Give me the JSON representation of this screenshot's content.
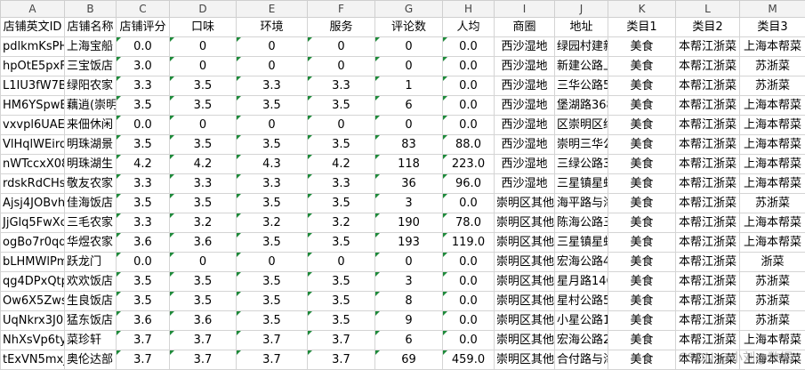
{
  "columns": [
    "A",
    "B",
    "C",
    "D",
    "E",
    "F",
    "G",
    "H",
    "I",
    "J",
    "K",
    "L",
    "M"
  ],
  "headers": [
    "店铺英文ID",
    "店铺名称",
    "店铺评分",
    "口味",
    "环境",
    "服务",
    "评论数",
    "人均",
    "商圈",
    "地址",
    "类目1",
    "类目2",
    "类目3"
  ],
  "rows": [
    [
      "pdlkmKsPH",
      "上海宝船",
      "0.0",
      "0",
      "0",
      "0",
      "0",
      "0.0",
      "西沙湿地",
      "绿园村建新",
      "美食",
      "本帮江浙菜",
      "上海本帮菜"
    ],
    [
      "hpOtE5pxFl",
      "三宝饭店",
      "3.0",
      "0",
      "0",
      "0",
      "0",
      "0.0",
      "西沙湿地",
      "新建公路上",
      "美食",
      "本帮江浙菜",
      "苏浙菜"
    ],
    [
      "L1IU3fW7B",
      "绿阳农家",
      "3.3",
      "3.5",
      "3.3",
      "3.3",
      "1",
      "0.0",
      "西沙湿地",
      "三华公路51",
      "美食",
      "本帮江浙菜",
      "苏浙菜"
    ],
    [
      "HM6YSpwB",
      "藕逍(崇明",
      "3.5",
      "3.5",
      "3.5",
      "3.5",
      "6",
      "0.0",
      "西沙湿地",
      "堡湖路368号",
      "美食",
      "本帮江浙菜",
      "上海本帮菜"
    ],
    [
      "vxvpl6UAEf",
      "来佃休闲",
      "0.0",
      "0",
      "0",
      "0",
      "0",
      "0.0",
      "西沙湿地",
      "区崇明区绿",
      "美食",
      "本帮江浙菜",
      "上海本帮菜"
    ],
    [
      "VlHqlWEird",
      "明珠湖景",
      "3.5",
      "3.5",
      "3.5",
      "3.5",
      "83",
      "88.0",
      "西沙湿地",
      "崇明三华公",
      "美食",
      "本帮江浙菜",
      "上海本帮菜"
    ],
    [
      "nWTccxX08",
      "明珠湖生",
      "4.2",
      "4.2",
      "4.3",
      "4.2",
      "118",
      "223.0",
      "西沙湿地",
      "三绿公路33",
      "美食",
      "本帮江浙菜",
      "上海本帮菜"
    ],
    [
      "rdskRdCHs",
      "敬友农家",
      "3.3",
      "3.3",
      "3.3",
      "3.3",
      "36",
      "96.0",
      "西沙湿地",
      "三星镇星虹",
      "美食",
      "本帮江浙菜",
      "上海本帮菜"
    ],
    [
      "Ajsj4JOBvh",
      "佳海饭店",
      "3.5",
      "3.5",
      "3.5",
      "3.5",
      "3",
      "0.0",
      "崇明区其他",
      "海平路与海",
      "美食",
      "本帮江浙菜",
      "苏浙菜"
    ],
    [
      "JjGlq5FwXc",
      "三毛农家",
      "3.3",
      "3.2",
      "3.2",
      "3.2",
      "190",
      "78.0",
      "崇明区其他",
      "陈海公路三",
      "美食",
      "本帮江浙菜",
      "上海本帮菜"
    ],
    [
      "ogBo7r0qqV",
      "华煜农家",
      "3.6",
      "3.6",
      "3.5",
      "3.5",
      "193",
      "119.0",
      "崇明区其他",
      "三星镇星虹",
      "美食",
      "本帮江浙菜",
      "上海本帮菜"
    ],
    [
      "bLHMWlPm",
      "跃龙门",
      "0.0",
      "0",
      "0",
      "0",
      "0",
      "0.0",
      "崇明区其他",
      "宏海公路42",
      "美食",
      "本帮江浙菜",
      "浙菜"
    ],
    [
      "qg4DPxQtp",
      "欢欢饭店",
      "3.5",
      "3.5",
      "3.5",
      "3.5",
      "3",
      "0.0",
      "崇明区其他",
      "星月路146号",
      "美食",
      "本帮江浙菜",
      "苏浙菜"
    ],
    [
      "Ow6X5Zwsu",
      "生良饭店",
      "3.5",
      "3.5",
      "3.5",
      "3.5",
      "8",
      "0.0",
      "崇明区其他",
      "星村公路59",
      "美食",
      "本帮江浙菜",
      "苏浙菜"
    ],
    [
      "UqNkrx3J0l",
      "猛东饭店",
      "3.6",
      "3.6",
      "3.5",
      "3.5",
      "9",
      "0.0",
      "崇明区其他",
      "小星公路12",
      "美食",
      "本帮江浙菜",
      "苏浙菜"
    ],
    [
      "NhXsVp6ty",
      "菜珍轩",
      "3.7",
      "3.7",
      "3.7",
      "3.7",
      "6",
      "0.0",
      "崇明区其他",
      "宏海公路20",
      "美食",
      "本帮江浙菜",
      "上海本帮菜"
    ],
    [
      "tExVN5mxj",
      "奥伦达部",
      "3.7",
      "3.7",
      "3.7",
      "3.7",
      "69",
      "459.0",
      "崇明区其他",
      "合付路与海",
      "美食",
      "本帮江浙菜",
      "上海本帮菜"
    ]
  ],
  "watermark": "CSDN @小刘@数据"
}
